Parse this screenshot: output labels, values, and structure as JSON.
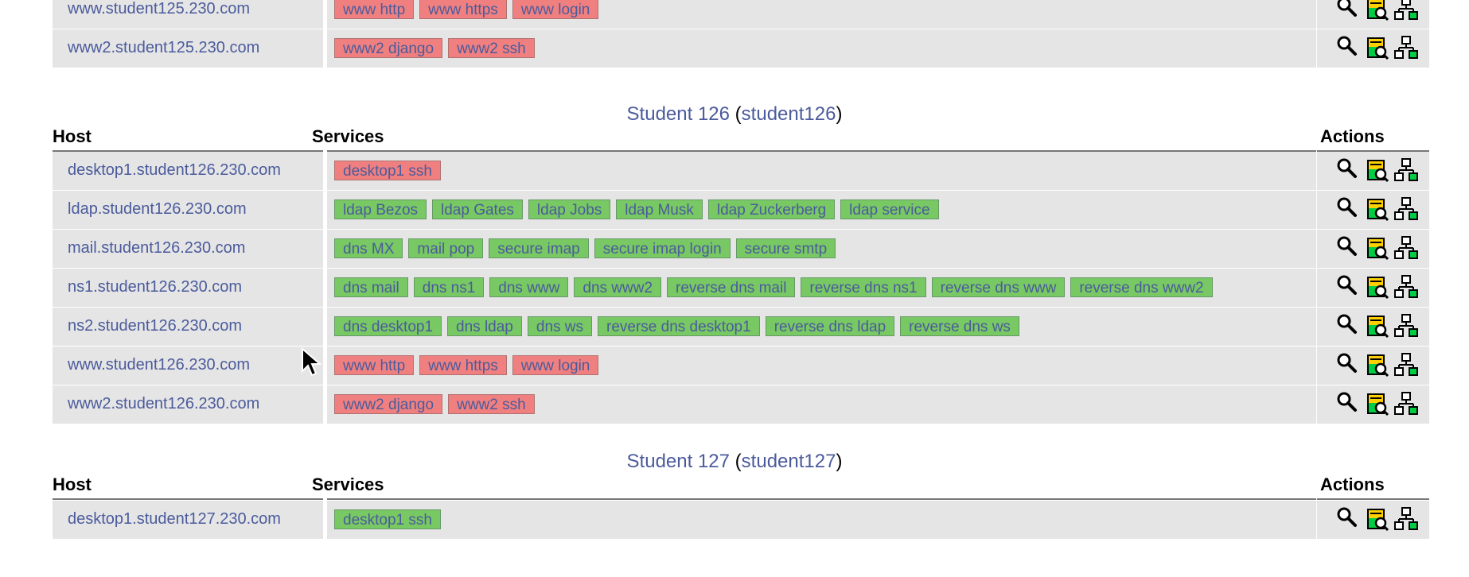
{
  "status_colors": {
    "ok": "#78c864",
    "critical": "#f08080",
    "link": "#4b5b9c",
    "row": "#e5e5e5"
  },
  "action_icons": [
    "magnifier-icon",
    "status-log-icon",
    "network-map-icon"
  ],
  "columns": {
    "host": "Host",
    "services": "Services",
    "actions": "Actions"
  },
  "top_rows": [
    {
      "host": "www.student125.230.com",
      "services": [
        {
          "name": "www http",
          "state": "critical"
        },
        {
          "name": "www https",
          "state": "critical"
        },
        {
          "name": "www login",
          "state": "critical"
        }
      ]
    },
    {
      "host": "www2.student125.230.com",
      "services": [
        {
          "name": "www2 django",
          "state": "critical"
        },
        {
          "name": "www2 ssh",
          "state": "critical"
        }
      ]
    }
  ],
  "student126": {
    "title_name": "Student 126",
    "title_id": "student126",
    "rows": [
      {
        "host": "desktop1.student126.230.com",
        "services": [
          {
            "name": "desktop1 ssh",
            "state": "critical"
          }
        ]
      },
      {
        "host": "ldap.student126.230.com",
        "services": [
          {
            "name": "ldap Bezos",
            "state": "ok"
          },
          {
            "name": "ldap Gates",
            "state": "ok"
          },
          {
            "name": "ldap Jobs",
            "state": "ok"
          },
          {
            "name": "ldap Musk",
            "state": "ok"
          },
          {
            "name": "ldap Zuckerberg",
            "state": "ok"
          },
          {
            "name": "ldap service",
            "state": "ok"
          }
        ]
      },
      {
        "host": "mail.student126.230.com",
        "services": [
          {
            "name": "dns MX",
            "state": "ok"
          },
          {
            "name": "mail pop",
            "state": "ok"
          },
          {
            "name": "secure imap",
            "state": "ok"
          },
          {
            "name": "secure imap login",
            "state": "ok"
          },
          {
            "name": "secure smtp",
            "state": "ok"
          }
        ]
      },
      {
        "host": "ns1.student126.230.com",
        "services": [
          {
            "name": "dns mail",
            "state": "ok"
          },
          {
            "name": "dns ns1",
            "state": "ok"
          },
          {
            "name": "dns www",
            "state": "ok"
          },
          {
            "name": "dns www2",
            "state": "ok"
          },
          {
            "name": "reverse dns mail",
            "state": "ok"
          },
          {
            "name": "reverse dns ns1",
            "state": "ok"
          },
          {
            "name": "reverse dns www",
            "state": "ok"
          },
          {
            "name": "reverse dns www2",
            "state": "ok"
          }
        ]
      },
      {
        "host": "ns2.student126.230.com",
        "services": [
          {
            "name": "dns desktop1",
            "state": "ok"
          },
          {
            "name": "dns ldap",
            "state": "ok"
          },
          {
            "name": "dns ws",
            "state": "ok"
          },
          {
            "name": "reverse dns desktop1",
            "state": "ok"
          },
          {
            "name": "reverse dns ldap",
            "state": "ok"
          },
          {
            "name": "reverse dns ws",
            "state": "ok"
          }
        ]
      },
      {
        "host": "www.student126.230.com",
        "services": [
          {
            "name": "www http",
            "state": "critical"
          },
          {
            "name": "www https",
            "state": "critical"
          },
          {
            "name": "www login",
            "state": "critical"
          }
        ]
      },
      {
        "host": "www2.student126.230.com",
        "services": [
          {
            "name": "www2 django",
            "state": "critical"
          },
          {
            "name": "www2 ssh",
            "state": "critical"
          }
        ]
      }
    ]
  },
  "student127": {
    "title_name": "Student 127",
    "title_id": "student127",
    "rows": [
      {
        "host": "desktop1.student127.230.com",
        "services": [
          {
            "name": "desktop1 ssh",
            "state": "ok"
          }
        ]
      }
    ]
  }
}
